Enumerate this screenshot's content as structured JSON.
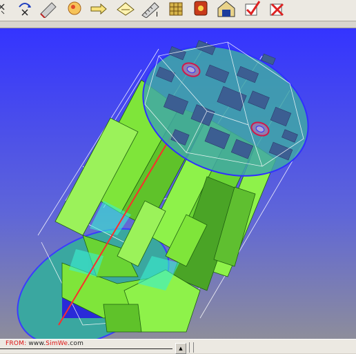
{
  "toolbar": {
    "tools": [
      {
        "name": "scale-tool-icon"
      },
      {
        "name": "rotate-tool-icon"
      },
      {
        "name": "pencil-tool-icon"
      },
      {
        "name": "hand-pan-icon"
      },
      {
        "name": "move-arrows-icon"
      },
      {
        "name": "push-pull-icon"
      },
      {
        "name": "measure-tool-icon"
      },
      {
        "name": "components-icon"
      },
      {
        "name": "materials-icon"
      },
      {
        "name": "warehouse-icon"
      },
      {
        "name": "validate-check-icon"
      },
      {
        "name": "delete-x-icon"
      }
    ],
    "cursor_glyph": "I"
  },
  "viewport": {
    "background_top": "#3b3bff",
    "background_bottom": "#8a8a9e",
    "model_color": "#86f23a",
    "cap_color": "#3aa6a0"
  },
  "statusbar": {
    "watermark_from": "FROM:",
    "watermark_url_prefix": " www.",
    "watermark_brand": "SimWe",
    "watermark_url_suffix": ".com",
    "scroll_glyph": "▲"
  }
}
